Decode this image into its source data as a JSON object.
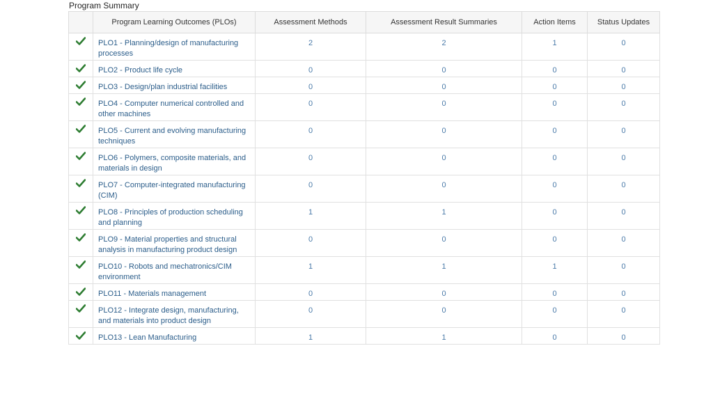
{
  "page_title": "Program Summary",
  "columns": [
    "",
    "Program Learning Outcomes (PLOs)",
    "Assessment Methods",
    "Assessment Result Summaries",
    "Action Items",
    "Status Updates"
  ],
  "colors": {
    "check": "#2e7d32",
    "link": "#2b5d8a",
    "number": "#4a7aa8"
  },
  "rows": [
    {
      "plo": "PLO1 - Planning/design of manufacturing processes",
      "methods": "2",
      "results": "2",
      "actions": "1",
      "status": "0",
      "tall": true
    },
    {
      "plo": "PLO2 - Product life cycle",
      "methods": "0",
      "results": "0",
      "actions": "0",
      "status": "0",
      "tall": false
    },
    {
      "plo": "PLO3 - Design/plan industrial facilities",
      "methods": "0",
      "results": "0",
      "actions": "0",
      "status": "0",
      "tall": false
    },
    {
      "plo": "PLO4 - Computer numerical controlled and other machines",
      "methods": "0",
      "results": "0",
      "actions": "0",
      "status": "0",
      "tall": true
    },
    {
      "plo": "PLO5 - Current and evolving manufacturing techniques",
      "methods": "0",
      "results": "0",
      "actions": "0",
      "status": "0",
      "tall": true
    },
    {
      "plo": "PLO6 - Polymers, composite materials, and materials in design",
      "methods": "0",
      "results": "0",
      "actions": "0",
      "status": "0",
      "tall": true
    },
    {
      "plo": "PLO7 - Computer-integrated manufacturing (CIM)",
      "methods": "0",
      "results": "0",
      "actions": "0",
      "status": "0",
      "tall": true
    },
    {
      "plo": "PLO8 - Principles of production scheduling and planning",
      "methods": "1",
      "results": "1",
      "actions": "0",
      "status": "0",
      "tall": true
    },
    {
      "plo": "PLO9 - Material properties and structural analysis in manufacturing product design",
      "methods": "0",
      "results": "0",
      "actions": "0",
      "status": "0",
      "tall": true
    },
    {
      "plo": "PLO10 - Robots and mechatronics/CIM environment",
      "methods": "1",
      "results": "1",
      "actions": "1",
      "status": "0",
      "tall": true
    },
    {
      "plo": "PLO11 - Materials management",
      "methods": "0",
      "results": "0",
      "actions": "0",
      "status": "0",
      "tall": false
    },
    {
      "plo": "PLO12 - Integrate design, manufacturing, and materials into product design",
      "methods": "0",
      "results": "0",
      "actions": "0",
      "status": "0",
      "tall": true
    },
    {
      "plo": "PLO13 - Lean Manufacturing",
      "methods": "1",
      "results": "1",
      "actions": "0",
      "status": "0",
      "tall": false
    }
  ]
}
